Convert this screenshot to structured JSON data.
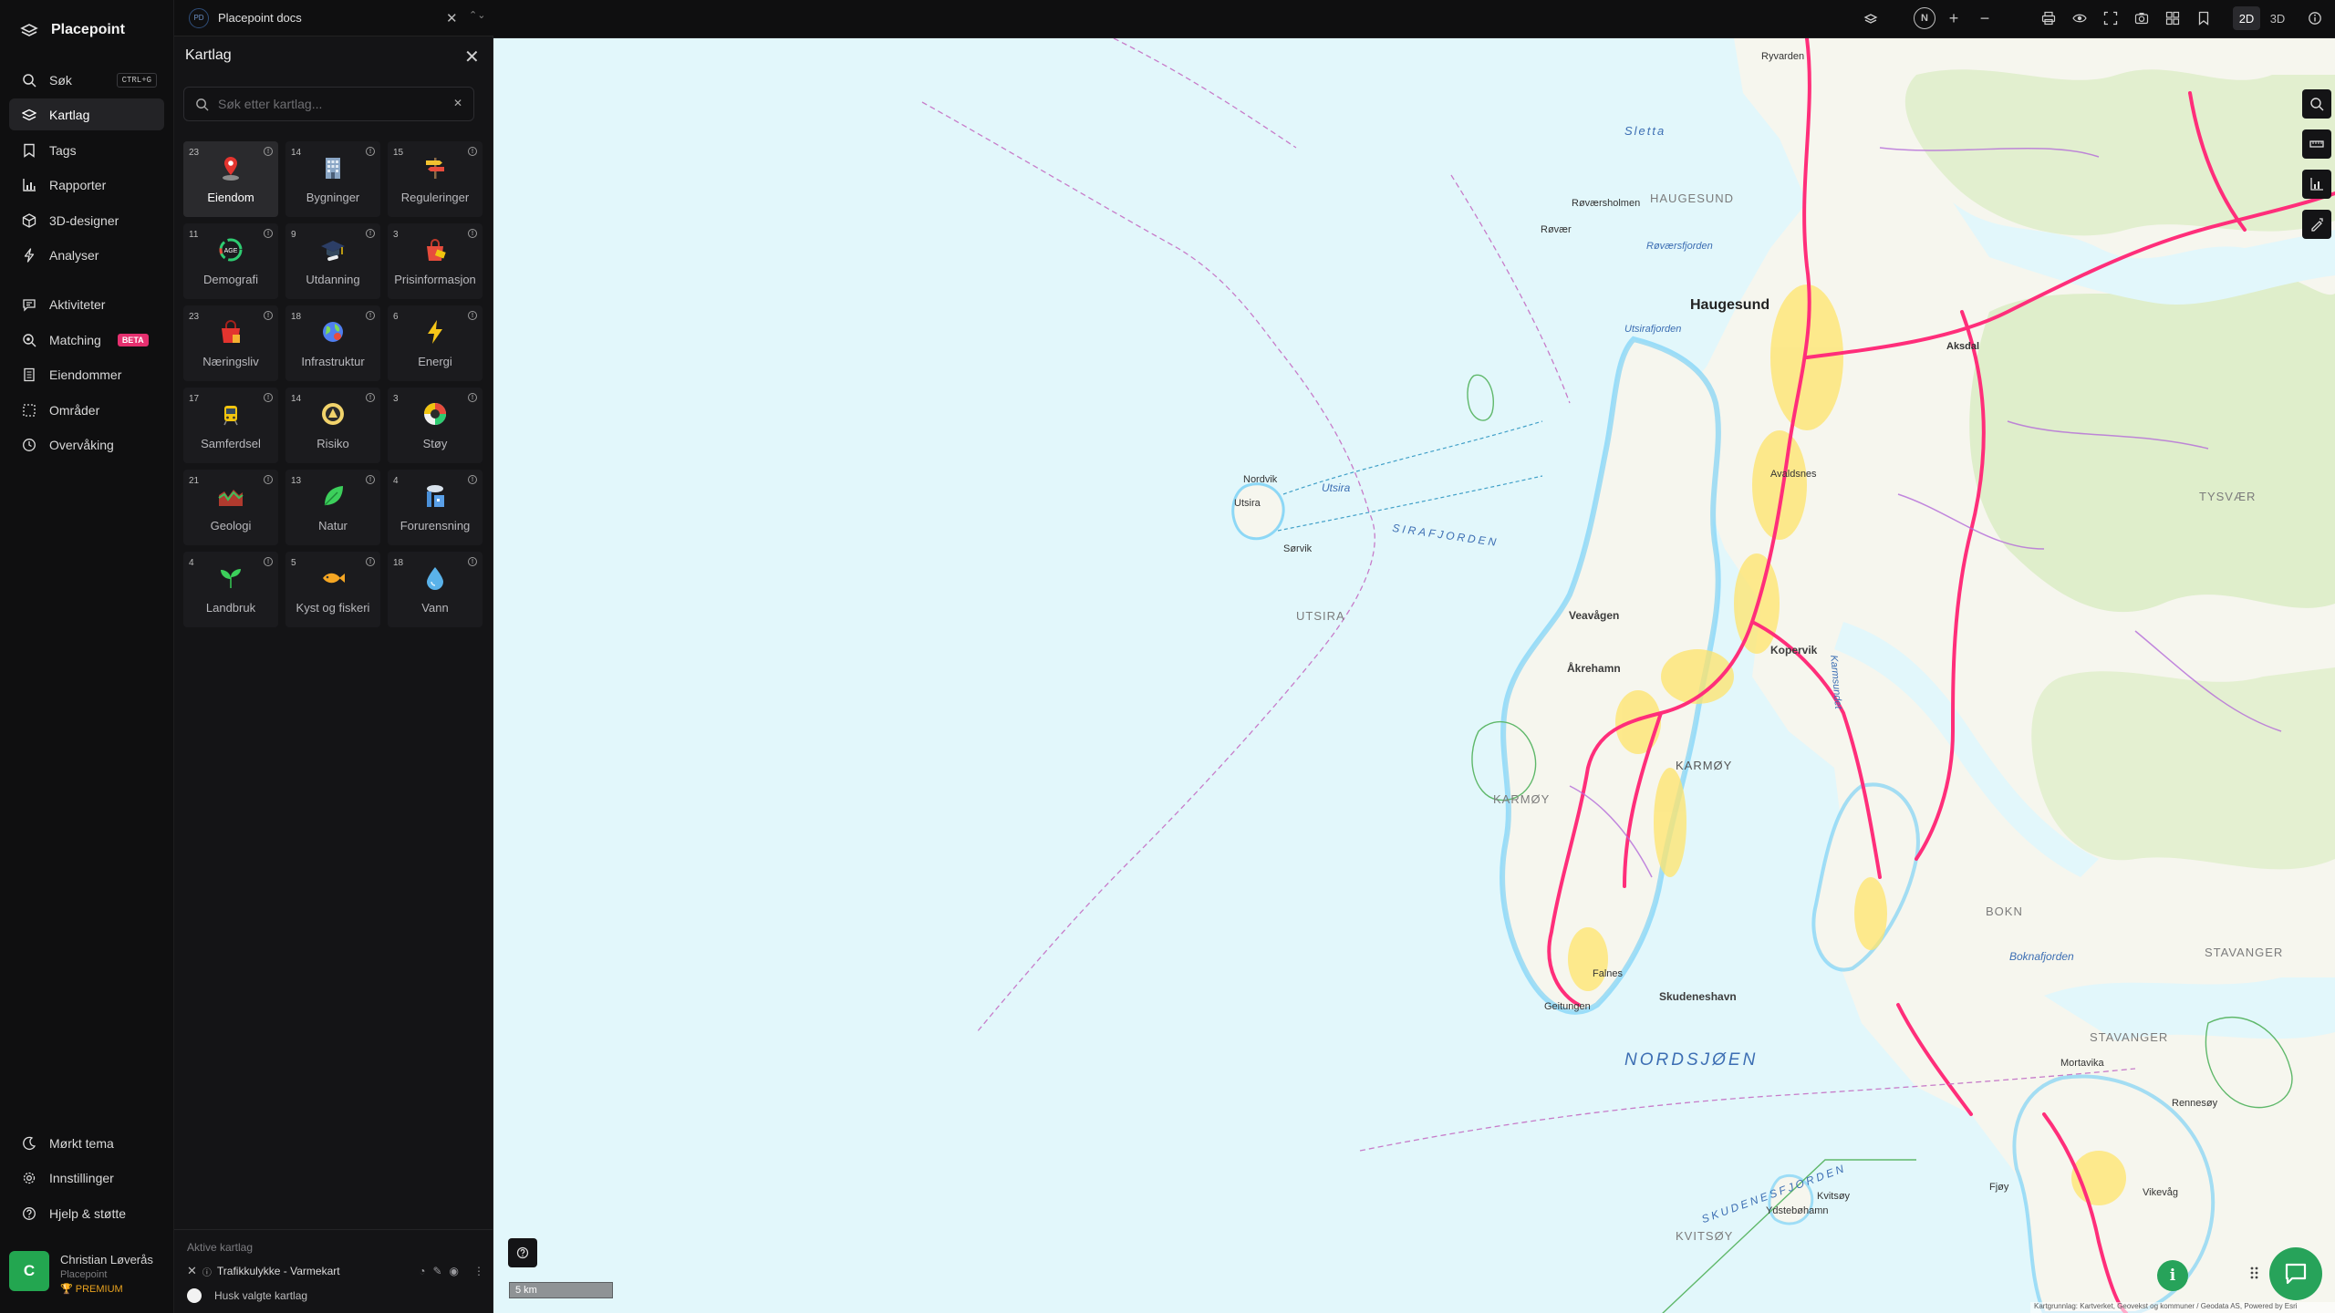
{
  "app": {
    "brand": "Placepoint"
  },
  "nav": {
    "top": [
      {
        "key": "search",
        "label": "Søk",
        "shortcut": "CTRL+G",
        "icon": "search-icon"
      },
      {
        "key": "kartlag",
        "label": "Kartlag",
        "active": true,
        "icon": "layers-icon"
      },
      {
        "key": "tags",
        "label": "Tags",
        "icon": "bookmark-icon"
      },
      {
        "key": "rapporter",
        "label": "Rapporter",
        "icon": "bar-chart-icon"
      },
      {
        "key": "3d",
        "label": "3D-designer",
        "icon": "cube-icon"
      },
      {
        "key": "analyser",
        "label": "Analyser",
        "icon": "lightning-icon"
      }
    ],
    "middle": [
      {
        "key": "aktiviteter",
        "label": "Aktiviteter",
        "icon": "chat-icon"
      },
      {
        "key": "matching",
        "label": "Matching",
        "badge": "BETA",
        "icon": "match-icon"
      },
      {
        "key": "eiendommer",
        "label": "Eiendommer",
        "icon": "building-icon"
      },
      {
        "key": "omrader",
        "label": "Områder",
        "icon": "area-icon"
      },
      {
        "key": "overvaking",
        "label": "Overvåking",
        "icon": "monitor-icon"
      }
    ],
    "bottom": [
      {
        "key": "tema",
        "label": "Mørkt tema",
        "icon": "moon-icon"
      },
      {
        "key": "innst",
        "label": "Innstillinger",
        "icon": "gear-icon"
      },
      {
        "key": "hjelp",
        "label": "Hjelp & støtte",
        "icon": "help-icon"
      }
    ],
    "user": {
      "initial": "C",
      "name": "Christian Løverås",
      "org": "Placepoint",
      "tier": "PREMIUM"
    }
  },
  "panel": {
    "tab": {
      "badge": "PD",
      "title": "Placepoint docs"
    },
    "title": "Kartlag",
    "search_placeholder": "Søk etter kartlag...",
    "tiles": [
      {
        "count": "23",
        "label": "Eiendom",
        "icon": "location-pin-icon",
        "active": true
      },
      {
        "count": "14",
        "label": "Bygninger",
        "icon": "office-building-icon"
      },
      {
        "count": "15",
        "label": "Reguleringer",
        "icon": "signpost-icon"
      },
      {
        "count": "11",
        "label": "Demografi",
        "icon": "age-gauge-icon"
      },
      {
        "count": "9",
        "label": "Utdanning",
        "icon": "graduation-cap-icon"
      },
      {
        "count": "3",
        "label": "Prisinformasjon",
        "icon": "price-bag-icon"
      },
      {
        "count": "23",
        "label": "Næringsliv",
        "icon": "shopping-bag-icon"
      },
      {
        "count": "18",
        "label": "Infrastruktur",
        "icon": "globe-icon"
      },
      {
        "count": "6",
        "label": "Energi",
        "icon": "lightning-bolt-icon"
      },
      {
        "count": "17",
        "label": "Samferdsel",
        "icon": "tram-icon"
      },
      {
        "count": "14",
        "label": "Risiko",
        "icon": "warning-sign-icon"
      },
      {
        "count": "3",
        "label": "Støy",
        "icon": "noise-gauge-icon"
      },
      {
        "count": "21",
        "label": "Geologi",
        "icon": "terrain-icon"
      },
      {
        "count": "13",
        "label": "Natur",
        "icon": "leaf-icon"
      },
      {
        "count": "4",
        "label": "Forurensning",
        "icon": "factory-icon"
      },
      {
        "count": "4",
        "label": "Landbruk",
        "icon": "sprout-icon"
      },
      {
        "count": "5",
        "label": "Kyst og fiskeri",
        "icon": "fish-icon"
      },
      {
        "count": "18",
        "label": "Vann",
        "icon": "water-drop-icon"
      }
    ],
    "active_layers": {
      "heading": "Aktive kartlag",
      "items": [
        {
          "label": "Trafikkulykke - Varmekart"
        }
      ],
      "remember_label": "Husk valgte kartlag"
    }
  },
  "toolbar": {
    "compass": "N",
    "view_modes": [
      {
        "label": "2D",
        "active": true
      },
      {
        "label": "3D",
        "active": false
      }
    ]
  },
  "map": {
    "labels": {
      "haugesund": "Haugesund",
      "haugesund_area": "HAUGESUND",
      "sletta": "Sletta",
      "utsira_region": "UTSIRA",
      "utsira": "Utsira",
      "utsira_town": "Utsira",
      "nordvik": "Nordvik",
      "sorvik": "Sørvik",
      "sirafjorden": "SIRAFJORDEN",
      "nordsjoen": "NORDSJØEN",
      "skudenesfjorden": "SKUDENESFJORDEN",
      "karmoy_region": "KARMØY",
      "karmoy_island": "KARMØY",
      "akrehamn": "Åkrehamn",
      "veavagen": "Veavågen",
      "kopervik": "Kopervik",
      "skudeneshavn": "Skudeneshavn",
      "stavanger_region": "STAVANGER",
      "stavanger": "STAVANGER",
      "bokn": "BOKN",
      "tysver": "TYSVÆR",
      "kvitsoy": "KVITSØY",
      "boknafjorden": "Boknafjorden",
      "utsirafjord": "Utsirafjorden",
      "roversholmen": "Røværsholmen",
      "rovaer": "Røvær",
      "roversfjorden": "Røværsfjorden",
      "ryvarden": "Ryvarden",
      "avaldsnes": "Avaldsnes",
      "karmsundet": "Karmsundet",
      "aksdal": "Aksdal",
      "geitungen": "Geitungen",
      "ydstebohamn": "Ydstebøhamn",
      "kvitsoy_town": "Kvitsøy",
      "vikevag": "Vikevåg",
      "rennesoy": "Rennesøy",
      "fjoy": "Fjøy",
      "mortavika": "Mortavika",
      "sirevag_hint": "Falnes"
    },
    "scale": "5 km",
    "attribution": "Kartgrunnlag: Kartverket, Geovekst og kommuner / Geodata AS, Powered by Esri"
  },
  "colors": {
    "accent": "#27a35a",
    "beta": "#e5306f",
    "premium": "#e8a21f",
    "sea": "#e2f7fb",
    "land": "#f5f5ee",
    "road_heat": "#ff2e7a"
  }
}
